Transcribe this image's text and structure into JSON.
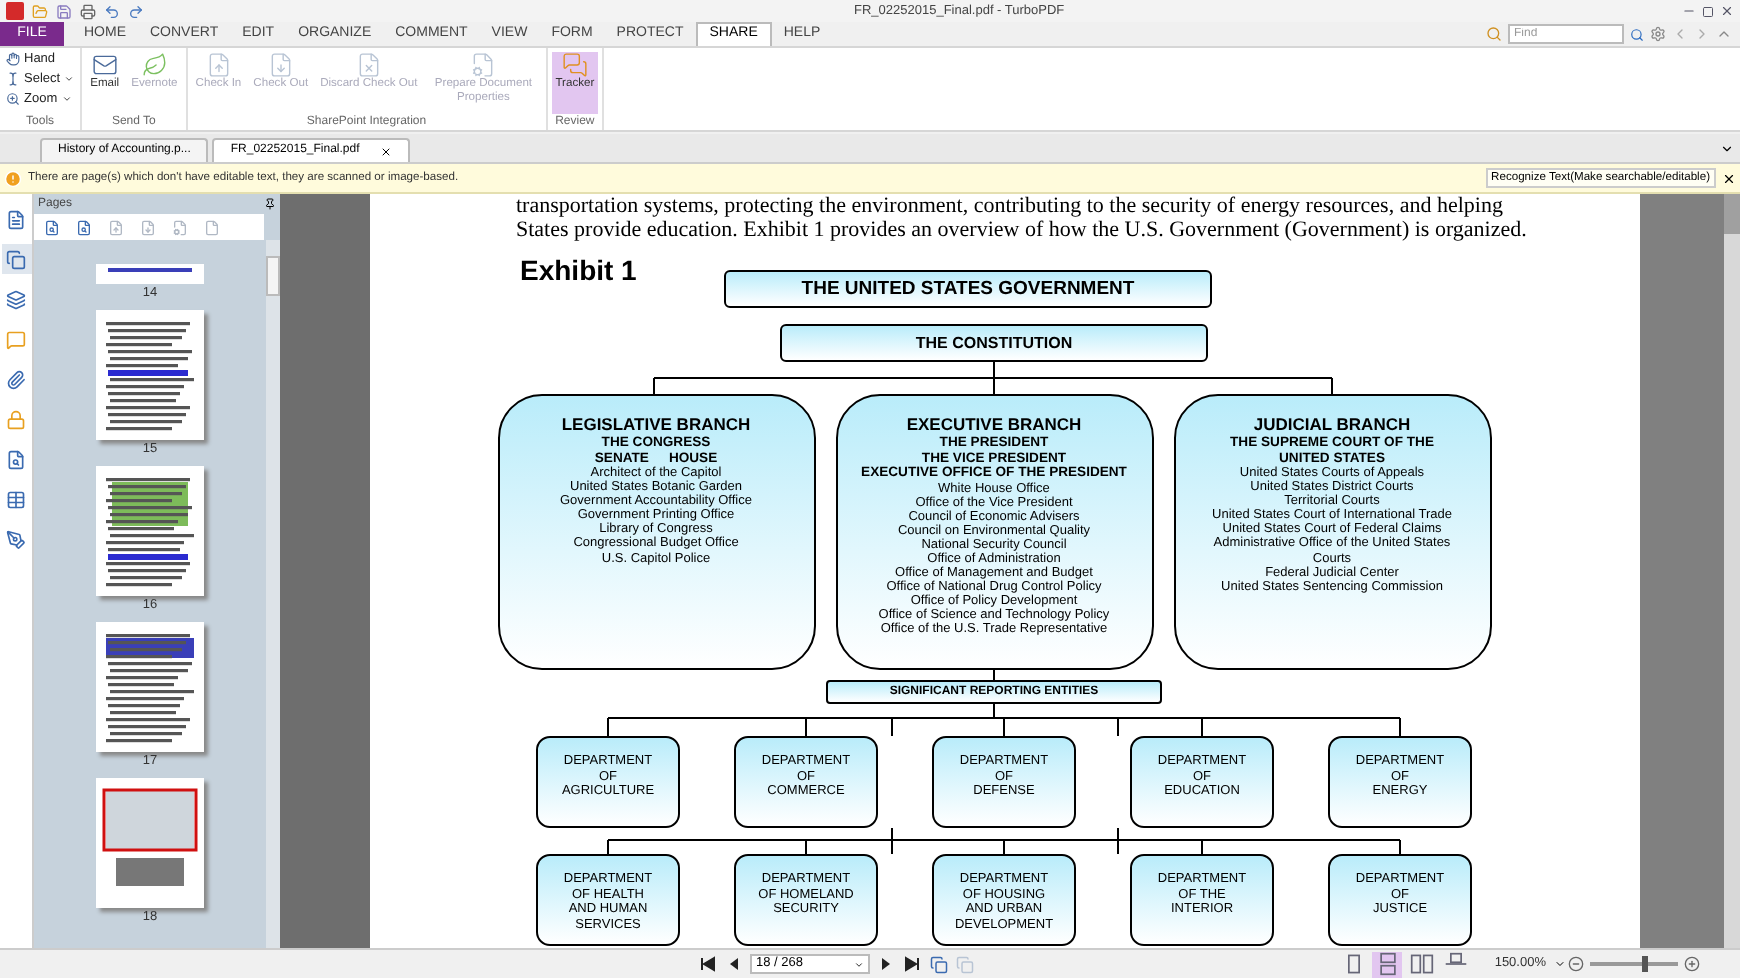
{
  "window": {
    "title": "FR_02252015_Final.pdf - TurboPDF"
  },
  "menu_tabs": [
    {
      "label": "FILE",
      "kind": "file",
      "selected": false
    },
    {
      "label": "HOME",
      "kind": "tab",
      "selected": false
    },
    {
      "label": "CONVERT",
      "kind": "tab",
      "selected": false
    },
    {
      "label": "EDIT",
      "kind": "tab",
      "selected": false
    },
    {
      "label": "ORGANIZE",
      "kind": "tab",
      "selected": false
    },
    {
      "label": "COMMENT",
      "kind": "tab",
      "selected": false
    },
    {
      "label": "VIEW",
      "kind": "tab",
      "selected": false
    },
    {
      "label": "FORM",
      "kind": "tab",
      "selected": false
    },
    {
      "label": "PROTECT",
      "kind": "tab",
      "selected": false
    },
    {
      "label": "SHARE",
      "kind": "tab",
      "selected": true
    },
    {
      "label": "HELP",
      "kind": "tab",
      "selected": false
    }
  ],
  "search": {
    "placeholder": "Find"
  },
  "ribbon": {
    "groups": [
      {
        "title": "Tools",
        "kind": "small",
        "items": [
          {
            "label": "Hand",
            "disabled": false,
            "active": false,
            "dropdown": false
          },
          {
            "label": "Select",
            "disabled": false,
            "active": false,
            "dropdown": true
          },
          {
            "label": "Zoom",
            "disabled": false,
            "active": false,
            "dropdown": true
          }
        ]
      },
      {
        "title": "Send To",
        "kind": "large",
        "items": [
          {
            "label": "Email",
            "disabled": false,
            "active": false
          },
          {
            "label": "Evernote",
            "disabled": true,
            "active": false
          }
        ]
      },
      {
        "title": "SharePoint Integration",
        "kind": "large",
        "items": [
          {
            "label": "Check In",
            "disabled": true,
            "active": false
          },
          {
            "label": "Check Out",
            "disabled": true,
            "active": false
          },
          {
            "label": "Discard Check Out",
            "disabled": true,
            "active": false
          },
          {
            "label": "Prepare Document Properties",
            "disabled": true,
            "active": false
          }
        ]
      },
      {
        "title": "Review",
        "kind": "large",
        "items": [
          {
            "label": "Tracker",
            "disabled": false,
            "active": true
          }
        ]
      }
    ]
  },
  "doc_tabs": [
    {
      "label": "History of Accounting.p...",
      "selected": false
    },
    {
      "label": "FR_02252015_Final.pdf",
      "selected": true
    }
  ],
  "notice": {
    "message": "There are page(s) which don't have editable text, they are scanned or image-based.",
    "button": "Recognize Text(Make searchable/editable)"
  },
  "sidebar_tools": [
    {
      "selected": false
    },
    {
      "selected": true
    },
    {
      "selected": false
    },
    {
      "selected": false
    },
    {
      "selected": false
    },
    {
      "selected": false
    },
    {
      "selected": false
    },
    {
      "selected": false
    },
    {
      "selected": false
    }
  ],
  "pages_panel": {
    "title": "Pages",
    "thumbnails": [
      {
        "label": "14",
        "selected": false
      },
      {
        "label": "15",
        "selected": false
      },
      {
        "label": "16",
        "selected": false
      },
      {
        "label": "17",
        "selected": false
      },
      {
        "label": "18",
        "selected": true
      }
    ]
  },
  "document": {
    "paragraph_lines": [
      "transportation systems, protecting the environment, contributing to the security of energy resources, and helping",
      "States provide education.  Exhibit 1 provides an overview of how the U.S. Government (Government) is organized."
    ],
    "exhibit": "Exhibit 1",
    "top": "THE UNITED STATES GOVERNMENT",
    "constitution": "THE CONSTITUTION",
    "branches": [
      {
        "title": "LEGISLATIVE BRANCH",
        "heads": [
          [
            "THE CONGRESS"
          ],
          [
            "SENATE",
            "HOUSE"
          ]
        ],
        "items": [
          "Architect of the Capitol",
          "United States Botanic Garden",
          "Government Accountability Office",
          "Government Printing Office",
          "Library of Congress",
          "Congressional Budget Office",
          "U.S. Capitol Police"
        ]
      },
      {
        "title": "EXECUTIVE BRANCH",
        "heads": [
          [
            "THE PRESIDENT"
          ],
          [
            "THE VICE PRESIDENT"
          ],
          [
            "EXECUTIVE OFFICE OF THE PRESIDENT"
          ]
        ],
        "items": [
          "White House Office",
          "Office of the Vice President",
          "Council of Economic Advisers",
          "Council on Environmental Quality",
          "National Security Council",
          "Office of Administration",
          "Office of Management and Budget",
          "Office of National Drug Control Policy",
          "Office of Policy Development",
          "Office of Science and Technology Policy",
          "Office of the U.S. Trade Representative"
        ]
      },
      {
        "title": "JUDICIAL BRANCH",
        "heads": [
          [
            "THE SUPREME COURT OF THE\nUNITED STATES"
          ]
        ],
        "items": [
          "United States Courts of Appeals",
          "United States District Courts",
          "Territorial Courts",
          "United States Court of International Trade",
          "United States Court of Federal Claims",
          "Administrative Office of the United States\nCourts",
          "Federal Judicial Center",
          "United States Sentencing Commission"
        ]
      }
    ],
    "entities": "SIGNIFICANT REPORTING ENTITIES",
    "department_rows": [
      [
        "DEPARTMENT\nOF\nAGRICULTURE",
        "DEPARTMENT\nOF\nCOMMERCE",
        "DEPARTMENT\nOF\nDEFENSE",
        "DEPARTMENT\nOF\nEDUCATION",
        "DEPARTMENT\nOF\nENERGY"
      ],
      [
        "DEPARTMENT\nOF HEALTH\nAND HUMAN\nSERVICES",
        "DEPARTMENT\nOF HOMELAND\nSECURITY",
        "DEPARTMENT\nOF HOUSING\nAND URBAN\nDEVELOPMENT",
        "DEPARTMENT\nOF THE\nINTERIOR",
        "DEPARTMENT\nOF\nJUSTICE"
      ]
    ]
  },
  "status_bar": {
    "page_field": "18 / 268",
    "view_modes": [
      {
        "kind": "single",
        "selected": false
      },
      {
        "kind": "continuous",
        "selected": true
      },
      {
        "kind": "facing",
        "selected": false
      },
      {
        "kind": "split",
        "selected": false
      }
    ],
    "zoom": "150.00%",
    "zoom_slider": {
      "level": 0.6
    }
  }
}
